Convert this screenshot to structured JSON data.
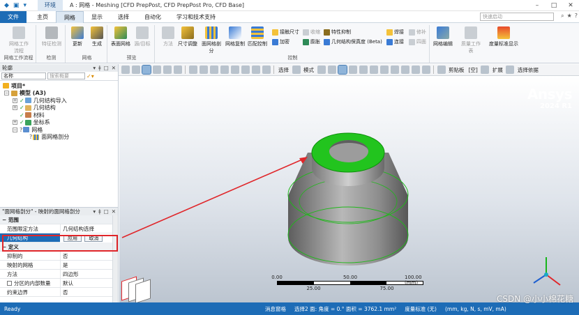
{
  "titlebar": {
    "context_tab": "环境",
    "title": "A : 网格 - Meshing [CFD PrepPost, CFD PrepPost Pro, CFD Base]",
    "controls": [
      "–",
      "□",
      "✕"
    ]
  },
  "ribbon_tabs": {
    "tabs": [
      "文件",
      "主页",
      "网格",
      "显示",
      "选择",
      "自动化",
      "学习和技术支持"
    ],
    "active_index": 2,
    "search_placeholder": "快速启动"
  },
  "ribbon": {
    "groups": [
      {
        "label": "网格工作流程",
        "buttons": [
          "网格工作流程"
        ]
      },
      {
        "label": "检测",
        "buttons": [
          "特征检测"
        ]
      },
      {
        "label": "网格",
        "buttons": [
          "更新",
          "生成"
        ]
      },
      {
        "label": "预览",
        "buttons": [
          "表面网格",
          "源/目标"
        ]
      },
      {
        "label": "控制",
        "buttons": [
          "方法",
          "尺寸调整",
          "面网格剖分",
          "网格复制",
          "匹配控制"
        ],
        "small": [
          "接触尺寸",
          "收缩",
          "加密",
          "膨胀",
          "特性抑制",
          "几何结构保真度 (Beta)",
          "焊接",
          "修补",
          "连接",
          "四面"
        ]
      },
      {
        "label": "",
        "buttons": [
          "网格编辑",
          "质量工作表",
          "度量标准显示"
        ]
      }
    ]
  },
  "toolbar": {
    "select_label": "选择",
    "mode_label": "模式",
    "clipboard_label": "剪贴板",
    "empty_label": "[空]",
    "expand_label": "扩展",
    "select_by_label": "选择依据"
  },
  "outline": {
    "title": "轮廓",
    "filter_select": "名称",
    "filter_placeholder": "搜索概要",
    "tree": [
      {
        "label": "项目*",
        "level": 0
      },
      {
        "label": "模型 (A3)",
        "level": 1
      },
      {
        "label": "几何结构导入",
        "level": 2
      },
      {
        "label": "几何结构",
        "level": 2
      },
      {
        "label": "材料",
        "level": 2
      },
      {
        "label": "坐标系",
        "level": 2
      },
      {
        "label": "网格",
        "level": 2
      },
      {
        "label": "面网格剖分",
        "level": 3
      }
    ]
  },
  "details": {
    "title": "\"面网格剖分\" - 映射的面网格剖分",
    "rows": [
      {
        "section": "范围"
      },
      {
        "k": "范围限定方法",
        "v": "几何结构选择"
      },
      {
        "k": "几何结构",
        "v": "",
        "selected": true
      },
      {
        "section": "定义"
      },
      {
        "k": "抑制的",
        "v": "否"
      },
      {
        "k": "映射的网格",
        "v": "是"
      },
      {
        "k": "方法",
        "v": "四边形"
      },
      {
        "k": "分区的内部数量",
        "v": "默认"
      },
      {
        "k": "约束边界",
        "v": "否"
      }
    ],
    "apply_label": "应用",
    "cancel_label": "取消"
  },
  "viewport": {
    "logo_brand": "Ansys",
    "logo_version": "2024 R1",
    "scale_top": [
      "0.00",
      "50.00",
      "100.00 (mm)"
    ],
    "scale_bottom": [
      "25.00",
      "75.00"
    ],
    "highlight_color": "#22c41e",
    "accent_color": "#e0262a"
  },
  "statusbar": {
    "ready": "Ready",
    "messages": "消息窗格",
    "selection": "选择2 面: 角度 = 0.° 面积 = 3762.1 mm²",
    "metric": "度量标准 (无)",
    "units": "(mm, kg, N, s, mV, mA)"
  },
  "watermark": "CSDN @小小棉花糖"
}
